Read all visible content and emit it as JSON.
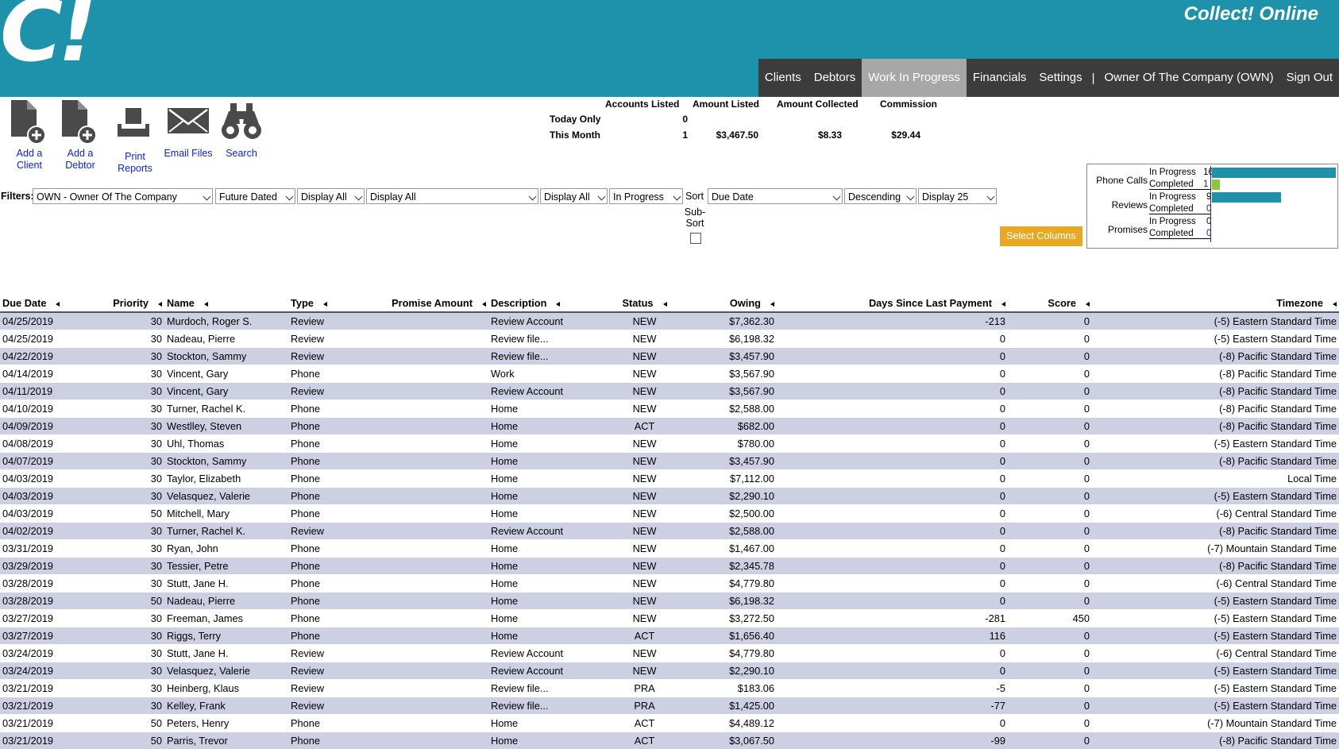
{
  "app": {
    "logo": "C!",
    "title": "Collect! Online"
  },
  "nav": {
    "items": [
      "Clients",
      "Debtors",
      "Work In Progress",
      "Financials",
      "Settings"
    ],
    "active": "Work In Progress",
    "separator": "|",
    "user": "Owner Of The Company (OWN)",
    "signout": "Sign Out"
  },
  "toolbar": {
    "add_client": "Add a Client",
    "add_debtor": "Add a Debtor",
    "print_reports": "Print Reports",
    "email_files": "Email Files",
    "search": "Search"
  },
  "stats": {
    "headers": [
      "Accounts Listed",
      "Amount Listed",
      "Amount Collected",
      "Commission"
    ],
    "today_label": "Today Only",
    "today_accounts": "0",
    "month_label": "This Month",
    "month_accounts": "1",
    "month_amount_listed": "$3,467.50",
    "month_amount_collected": "$8.33",
    "month_commission": "$29.44"
  },
  "filters": {
    "label": "Filters:",
    "owner": "OWN - Owner Of The Company",
    "dated": "Future Dated",
    "display1": "Display All",
    "display2": "Display All",
    "display3": "Display All",
    "status": "In Progress",
    "sort_label": "Sort",
    "sort": "Due Date",
    "order": "Descending",
    "page_size": "Display 25",
    "subsort_label": "Sub-Sort",
    "subsort_checked": false,
    "select_columns": "Select Columns"
  },
  "summary": {
    "phone_label": "Phone Calls",
    "reviews_label": "Reviews",
    "promises_label": "Promises",
    "in_progress_label": "In Progress",
    "completed_label": "Completed",
    "phone_in_progress": "16",
    "phone_completed": "1",
    "reviews_in_progress": "9",
    "reviews_completed": "0",
    "promises_in_progress": "0",
    "promises_completed": "0",
    "bar_color": "#1f92ab",
    "completed_bar_color": "#8cc63f"
  },
  "table": {
    "columns": [
      "Due Date",
      "Priority",
      "Name",
      "Type",
      "Promise Amount",
      "Description",
      "Status",
      "Owing",
      "Days Since Last Payment",
      "Score",
      "Timezone"
    ],
    "rows": [
      [
        "04/25/2019",
        "30",
        "Murdoch, Roger S.",
        "Review",
        "",
        "Review Account",
        "NEW",
        "$7,362.30",
        "-213",
        "0",
        "(-5) Eastern Standard Time"
      ],
      [
        "04/25/2019",
        "30",
        "Nadeau, Pierre",
        "Review",
        "",
        "Review file...",
        "NEW",
        "$6,198.32",
        "0",
        "0",
        "(-5) Eastern Standard Time"
      ],
      [
        "04/22/2019",
        "30",
        "Stockton, Sammy",
        "Review",
        "",
        "Review file...",
        "NEW",
        "$3,457.90",
        "0",
        "0",
        "(-8) Pacific Standard Time"
      ],
      [
        "04/14/2019",
        "30",
        "Vincent, Gary",
        "Phone",
        "",
        "Work",
        "NEW",
        "$3,567.90",
        "0",
        "0",
        "(-8) Pacific Standard Time"
      ],
      [
        "04/11/2019",
        "30",
        "Vincent, Gary",
        "Review",
        "",
        "Review Account",
        "NEW",
        "$3,567.90",
        "0",
        "0",
        "(-8) Pacific Standard Time"
      ],
      [
        "04/10/2019",
        "30",
        "Turner, Rachel K.",
        "Phone",
        "",
        "Home",
        "NEW",
        "$2,588.00",
        "0",
        "0",
        "(-8) Pacific Standard Time"
      ],
      [
        "04/09/2019",
        "30",
        "Westlley, Steven",
        "Phone",
        "",
        "Home",
        "ACT",
        "$682.00",
        "0",
        "0",
        "(-8) Pacific Standard Time"
      ],
      [
        "04/08/2019",
        "30",
        "Uhl, Thomas",
        "Phone",
        "",
        "Home",
        "NEW",
        "$780.00",
        "0",
        "0",
        "(-5) Eastern Standard Time"
      ],
      [
        "04/07/2019",
        "30",
        "Stockton, Sammy",
        "Phone",
        "",
        "Home",
        "NEW",
        "$3,457.90",
        "0",
        "0",
        "(-8) Pacific Standard Time"
      ],
      [
        "04/03/2019",
        "30",
        "Taylor, Elizabeth",
        "Phone",
        "",
        "Home",
        "NEW",
        "$7,112.00",
        "0",
        "0",
        "Local Time"
      ],
      [
        "04/03/2019",
        "30",
        "Velasquez, Valerie",
        "Phone",
        "",
        "Home",
        "NEW",
        "$2,290.10",
        "0",
        "0",
        "(-5) Eastern Standard Time"
      ],
      [
        "04/03/2019",
        "50",
        "Mitchell, Mary",
        "Phone",
        "",
        "Home",
        "NEW",
        "$2,500.00",
        "0",
        "0",
        "(-6) Central Standard Time"
      ],
      [
        "04/02/2019",
        "30",
        "Turner, Rachel K.",
        "Review",
        "",
        "Review Account",
        "NEW",
        "$2,588.00",
        "0",
        "0",
        "(-8) Pacific Standard Time"
      ],
      [
        "03/31/2019",
        "30",
        "Ryan, John",
        "Phone",
        "",
        "Home",
        "NEW",
        "$1,467.00",
        "0",
        "0",
        "(-7) Mountain Standard Time"
      ],
      [
        "03/29/2019",
        "30",
        "Tessier, Petre",
        "Phone",
        "",
        "Home",
        "NEW",
        "$2,345.78",
        "0",
        "0",
        "(-8) Pacific Standard Time"
      ],
      [
        "03/28/2019",
        "30",
        "Stutt, Jane H.",
        "Phone",
        "",
        "Home",
        "NEW",
        "$4,779.80",
        "0",
        "0",
        "(-6) Central Standard Time"
      ],
      [
        "03/28/2019",
        "50",
        "Nadeau, Pierre",
        "Phone",
        "",
        "Home",
        "NEW",
        "$6,198.32",
        "0",
        "0",
        "(-5) Eastern Standard Time"
      ],
      [
        "03/27/2019",
        "30",
        "Freeman, James",
        "Phone",
        "",
        "Home",
        "NEW",
        "$3,272.50",
        "-281",
        "450",
        "(-5) Eastern Standard Time"
      ],
      [
        "03/27/2019",
        "30",
        "Riggs, Terry",
        "Phone",
        "",
        "Home",
        "ACT",
        "$1,656.40",
        "116",
        "0",
        "(-5) Eastern Standard Time"
      ],
      [
        "03/24/2019",
        "30",
        "Stutt, Jane H.",
        "Review",
        "",
        "Review Account",
        "NEW",
        "$4,779.80",
        "0",
        "0",
        "(-6) Central Standard Time"
      ],
      [
        "03/24/2019",
        "30",
        "Velasquez, Valerie",
        "Review",
        "",
        "Review Account",
        "NEW",
        "$2,290.10",
        "0",
        "0",
        "(-5) Eastern Standard Time"
      ],
      [
        "03/21/2019",
        "30",
        "Heinberg, Klaus",
        "Review",
        "",
        "Review file...",
        "PRA",
        "$183.06",
        "-5",
        "0",
        "(-5) Eastern Standard Time"
      ],
      [
        "03/21/2019",
        "30",
        "Kelley, Frank",
        "Review",
        "",
        "Review file...",
        "PRA",
        "$1,425.00",
        "-77",
        "0",
        "(-5) Eastern Standard Time"
      ],
      [
        "03/21/2019",
        "50",
        "Peters, Henry",
        "Phone",
        "",
        "Home",
        "ACT",
        "$4,489.12",
        "0",
        "0",
        "(-7) Mountain Standard Time"
      ],
      [
        "03/21/2019",
        "50",
        "Parris, Trevor",
        "Phone",
        "",
        "Home",
        "ACT",
        "$3,067.50",
        "-99",
        "0",
        "(-8) Pacific Standard Time"
      ]
    ]
  }
}
